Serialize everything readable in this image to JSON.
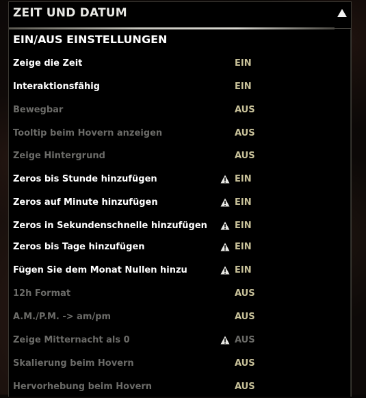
{
  "header": {
    "title": "ZEIT UND DATUM"
  },
  "section": {
    "title": "EIN/AUS EINSTELLUNGEN"
  },
  "rows": [
    {
      "label": "Zeige die Zeit",
      "value": "EIN",
      "enabled": true,
      "warning": false
    },
    {
      "label": "Interaktionsfähig",
      "value": "EIN",
      "enabled": true,
      "warning": false
    },
    {
      "label": "Bewegbar",
      "value": "AUS",
      "enabled": false,
      "warning": false
    },
    {
      "label": "Tooltip beim Hovern anzeigen",
      "value": "AUS",
      "enabled": false,
      "warning": false
    },
    {
      "label": "Zeige Hintergrund",
      "value": "AUS",
      "enabled": false,
      "warning": false
    },
    {
      "label": "Zeros bis Stunde hinzufügen",
      "value": "EIN",
      "enabled": true,
      "warning": true
    },
    {
      "label": "Zeros auf Minute hinzufügen",
      "value": "EIN",
      "enabled": true,
      "warning": true
    },
    {
      "label": "Zeros in Sekundenschnelle hinzufügen",
      "value": "EIN",
      "enabled": true,
      "warning": true
    },
    {
      "label": "Zeros bis Tage hinzufügen",
      "value": "EIN",
      "enabled": true,
      "warning": true
    },
    {
      "label": "Fügen Sie dem Monat Nullen hinzu",
      "value": "EIN",
      "enabled": true,
      "warning": true
    },
    {
      "label": "12h Format",
      "value": "AUS",
      "enabled": false,
      "warning": false
    },
    {
      "label": "A.M./P.M. -> am/pm",
      "value": "AUS",
      "enabled": false,
      "warning": false
    },
    {
      "label": "Zeige Mitternacht als 0",
      "value": "AUS",
      "enabled": false,
      "warning": true,
      "value_disabled": true
    },
    {
      "label": "Skalierung beim Hovern",
      "value": "AUS",
      "enabled": false,
      "warning": false
    },
    {
      "label": "Hervorhebung beim Hovern",
      "value": "AUS",
      "enabled": false,
      "warning": false
    }
  ],
  "icons": {
    "collapse": "triangle-up-icon",
    "warning": "warning-icon"
  },
  "colors": {
    "on_label": "#ffffff",
    "off_label": "#6b6b68",
    "value": "#c9c29a"
  }
}
